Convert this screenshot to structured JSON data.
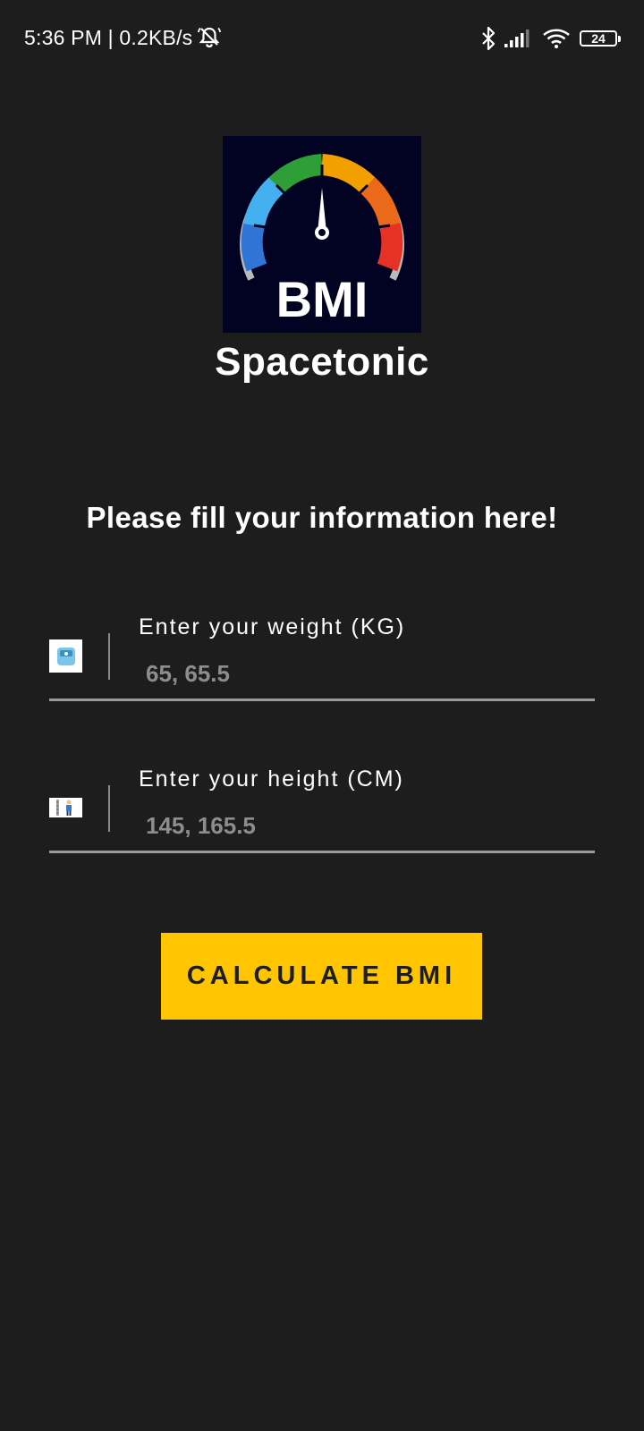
{
  "status_bar": {
    "time_speed": "5:36 PM | 0.2KB/s",
    "battery_level": "24",
    "icons": [
      "bell-muted-icon",
      "bluetooth-icon",
      "signal-icon",
      "wifi-icon",
      "battery-icon"
    ]
  },
  "logo": {
    "text": "BMI",
    "gauge_colors": [
      "#2f74d6",
      "#44b0f0",
      "#2e9e36",
      "#f2a000",
      "#ea6a1a",
      "#e63225"
    ]
  },
  "app_name": "Spacetonic",
  "prompt": "Please fill your information here!",
  "form": {
    "weight": {
      "label": "Enter your weight (KG)",
      "placeholder": "65, 65.5",
      "value": "",
      "icon": "scale-icon"
    },
    "height": {
      "label": "Enter your height (CM)",
      "placeholder": "145, 165.5",
      "value": "",
      "icon": "height-measure-icon"
    },
    "submit_label": "CALCULATE BMI"
  },
  "colors": {
    "background": "#1d1d1d",
    "accent": "#ffc600",
    "placeholder": "#8d8d8d"
  }
}
